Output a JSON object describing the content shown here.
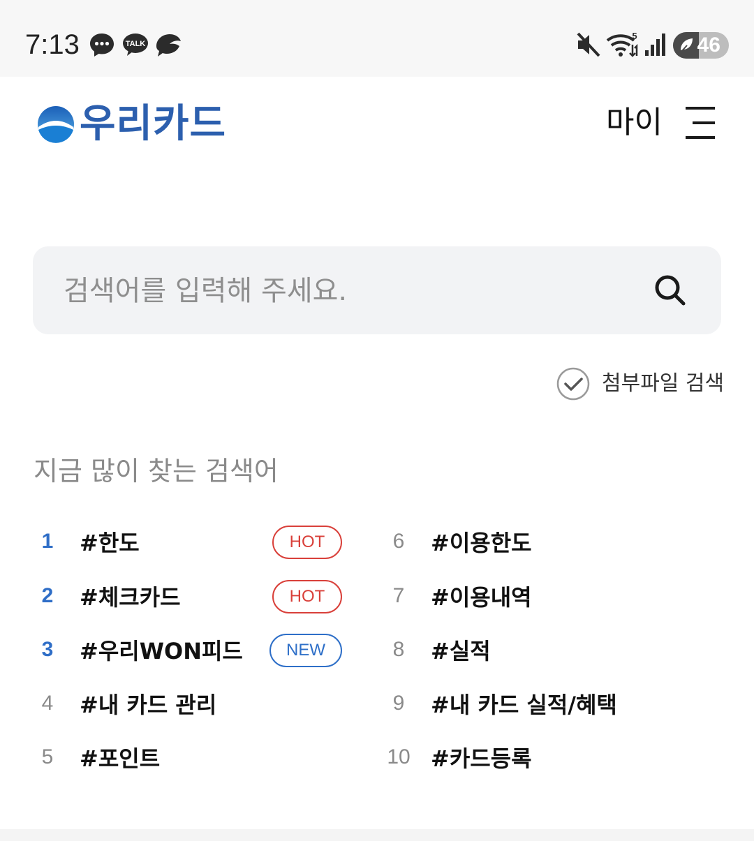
{
  "status_bar": {
    "time": "7:13",
    "notification_icons": [
      "messenger-icon",
      "kakaotalk-icon",
      "leaf-icon"
    ],
    "kakao_label": "TALK",
    "wifi_label": "5",
    "battery_level": "46",
    "battery_fraction": 0.46
  },
  "header": {
    "logo_text": "우리카드",
    "my_label": "마이",
    "brand_color": "#2c5fae"
  },
  "search": {
    "placeholder": "검색어를 입력해 주세요.",
    "attach_label": "첨부파일 검색"
  },
  "popular": {
    "title": "지금 많이 찾는 검색어",
    "left": [
      {
        "rank": "1",
        "keyword": "#한도",
        "badge": "HOT"
      },
      {
        "rank": "2",
        "keyword": "#체크카드",
        "badge": "HOT"
      },
      {
        "rank": "3",
        "keyword": "#우리WON피드",
        "badge": "NEW"
      },
      {
        "rank": "4",
        "keyword": "#내 카드 관리",
        "badge": ""
      },
      {
        "rank": "5",
        "keyword": "#포인트",
        "badge": ""
      }
    ],
    "right": [
      {
        "rank": "6",
        "keyword": "#이용한도",
        "badge": ""
      },
      {
        "rank": "7",
        "keyword": "#이용내역",
        "badge": ""
      },
      {
        "rank": "8",
        "keyword": "#실적",
        "badge": ""
      },
      {
        "rank": "9",
        "keyword": "#내 카드 실적/혜택",
        "badge": ""
      },
      {
        "rank": "10",
        "keyword": "#카드등록",
        "badge": ""
      }
    ],
    "hot_color": "#d9403a",
    "new_color": "#2e6fc8",
    "top_rank_color": "#2f6ec7"
  }
}
